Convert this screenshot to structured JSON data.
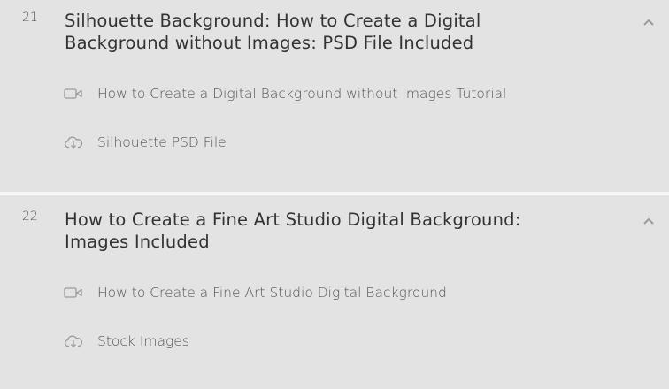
{
  "sections": [
    {
      "number": "21",
      "title_line1": "Silhouette Background: How to Create a Digital",
      "title_line2": "Background without Images: PSD File Included",
      "items": [
        {
          "icon": "video-camera-icon",
          "label": "How to Create a Digital Background without Images Tutorial"
        },
        {
          "icon": "cloud-download-icon",
          "label": "Silhouette PSD File"
        }
      ]
    },
    {
      "number": "22",
      "title_line1": "How to Create a Fine Art Studio Digital Background:",
      "title_line2": "Images Included",
      "items": [
        {
          "icon": "video-camera-icon",
          "label": "How to Create a Fine Art Studio Digital Background"
        },
        {
          "icon": "cloud-download-icon",
          "label": "Stock Images"
        }
      ]
    }
  ],
  "colors": {
    "background": "#e3e3e3",
    "divider": "#f6f6f6",
    "icon": "#9a9a9a"
  }
}
